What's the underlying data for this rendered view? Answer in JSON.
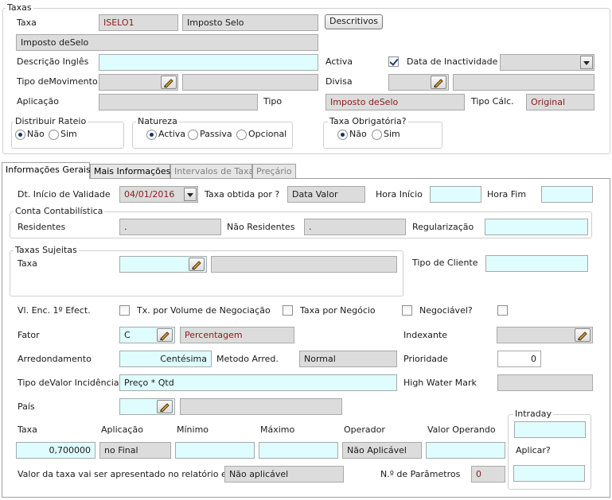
{
  "taxas": {
    "group_title": "Taxas",
    "taxa_label": "Taxa",
    "taxa_code": "ISELO1",
    "taxa_name": "Imposto Selo",
    "descritivos_button": "Descritivos",
    "description": "Imposto deSelo",
    "descricao_ingles_label": "Descrição Inglês",
    "descricao_ingles_value": "",
    "activa_label": "Activa",
    "activa_checked": true,
    "data_inactividade_label": "Data de Inactividade",
    "tipo_movimento_label": "Tipo deMovimento",
    "divisa_label": "Divisa",
    "aplicacao_label": "Aplicação",
    "tipo_label": "Tipo",
    "tipo_value": "Imposto deSelo",
    "tipo_calc_label": "Tipo Cálc.",
    "tipo_calc_value": "Original",
    "distribuir_rateio": {
      "title": "Distribuir Rateio",
      "nao": "Não",
      "sim": "Sim",
      "selected": "nao"
    },
    "natureza": {
      "title": "Natureza",
      "activa": "Activa",
      "passiva": "Passiva",
      "opcional": "Opcional",
      "selected": "activa"
    },
    "taxa_obrigatoria": {
      "title": "Taxa Obrigatória?",
      "nao": "Não",
      "sim": "Sim",
      "selected": "nao"
    }
  },
  "tabs": [
    {
      "label": "Informações Gerais",
      "active": true
    },
    {
      "label": "Mais Informações",
      "active": false
    },
    {
      "label": "Intervalos de Taxa",
      "active": false
    },
    {
      "label": "Preçário",
      "active": false
    }
  ],
  "gerais": {
    "dt_inicio_label": "Dt. Início de Validade",
    "dt_inicio_value": "04/01/2016",
    "taxa_obtida_label": "Taxa obtida por ?",
    "taxa_obtida_value": "Data Valor",
    "hora_inicio_label": "Hora Início",
    "hora_fim_label": "Hora Fim",
    "conta": {
      "title": "Conta Contabilística",
      "residentes_label": "Residentes",
      "residentes_value": ".",
      "nao_residentes_label": "Não Residentes",
      "nao_residentes_value": ".",
      "regularizacao_label": "Regularização"
    },
    "taxas_sujeitas": {
      "title": "Taxas Sujeitas",
      "taxa_label": "Taxa"
    },
    "tipo_cliente_label": "Tipo de Cliente",
    "vl_enc_label": "Vl. Enc. 1º Efect.",
    "tx_volume_label": "Tx. por Volume de Negociação",
    "taxa_negocio_label": "Taxa por Negócio",
    "negociavel_label": "Negociável?",
    "fator_label": "Fator",
    "fator_code": "C",
    "fator_name": "Percentagem",
    "indexante_label": "Indexante",
    "arredondamento_label": "Arredondamento",
    "arredondamento_value": "Centésima",
    "metodo_arred_label": "Metodo Arred.",
    "metodo_arred_value": "Normal",
    "prioridade_label": "Prioridade",
    "prioridade_value": "0",
    "tipo_valor_label": "Tipo deValor Incidência",
    "tipo_valor_value": "Preço * Qtd",
    "high_water_label": "High Water Mark",
    "pais_label": "País",
    "intraday_title": "Intraday",
    "aplicar_label": "Aplicar?",
    "table_headers": {
      "taxa": "Taxa",
      "aplicacao": "Aplicação",
      "minimo": "Mínimo",
      "maximo": "Máximo",
      "operador": "Operador",
      "valor_operando": "Valor Operando"
    },
    "taxa_value": "0,700000",
    "aplicacao_value": "no Final",
    "operador_value": "Não Aplicável",
    "valor_relatorio_label": "Valor da taxa vai ser apresentado no relatório em:",
    "valor_relatorio_value": "Não aplicável",
    "num_parametros_label": "N.º de Parâmetros",
    "num_parametros_value": "0"
  },
  "colors": {
    "field_cyan": "#dffcff",
    "field_gray": "#dcdcdc",
    "value_red": "#8b1a1a"
  }
}
